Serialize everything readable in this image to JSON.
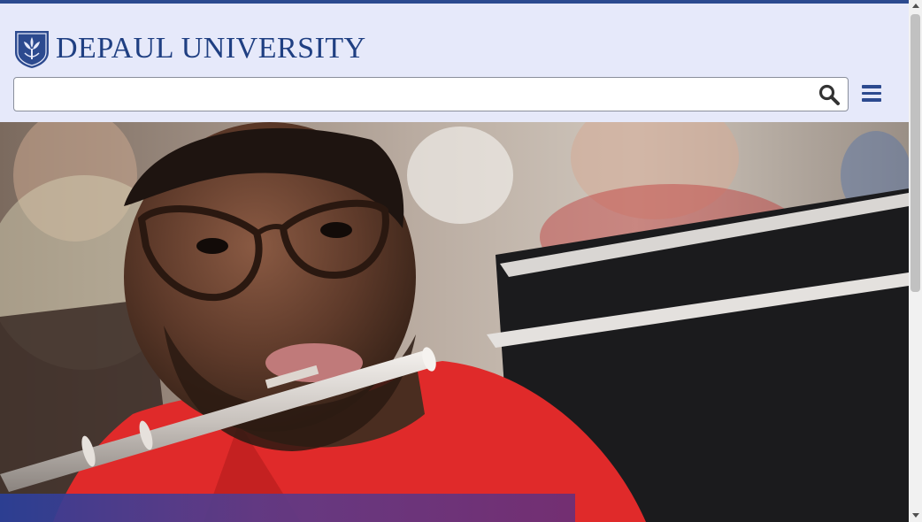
{
  "brand": {
    "logo_text_de": "DE",
    "logo_text_paul": "PAUL",
    "logo_text_university": "UNIVERSITY",
    "logo_color": "#1f3f82",
    "accent_bar_color": "#2c4a8f",
    "header_bg": "#e6e9fa"
  },
  "search": {
    "value": "",
    "placeholder": "",
    "icon": "search-icon"
  },
  "menu": {
    "icon": "hamburger-menu-icon"
  },
  "hero": {
    "image": "student-playing-flute-photo",
    "caption_band_colors": [
      "#2a3f9a",
      "#6a2f78"
    ]
  }
}
